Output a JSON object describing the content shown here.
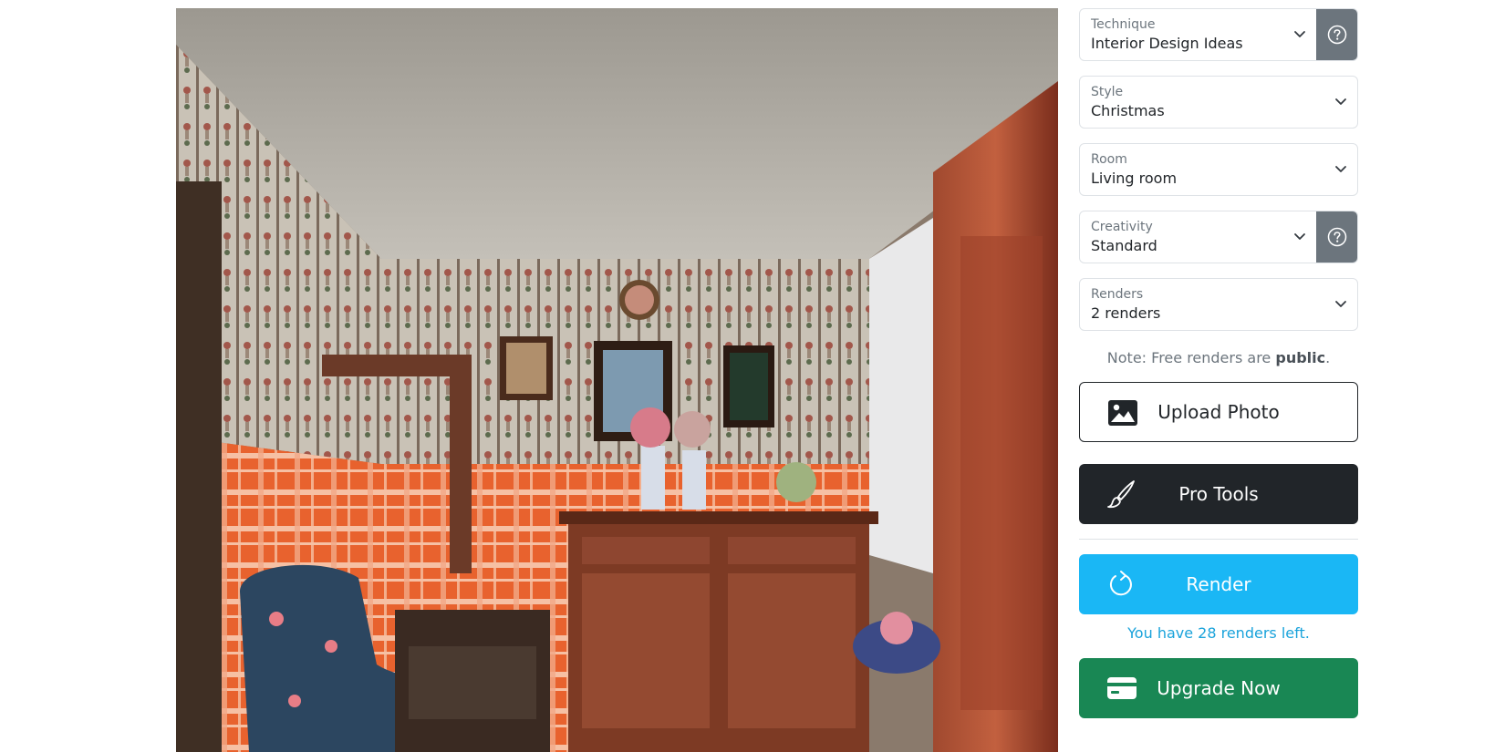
{
  "form": {
    "technique": {
      "label": "Technique",
      "value": "Interior Design Ideas"
    },
    "style": {
      "label": "Style",
      "value": "Christmas"
    },
    "room": {
      "label": "Room",
      "value": "Living room"
    },
    "creativity": {
      "label": "Creativity",
      "value": "Standard"
    },
    "renders": {
      "label": "Renders",
      "value": "2 renders"
    }
  },
  "note": {
    "prefix": "Note: Free renders are ",
    "emphasis": "public",
    "suffix": "."
  },
  "buttons": {
    "upload": "Upload Photo",
    "pro_tools": "Pro Tools",
    "render": "Render",
    "upgrade": "Upgrade Now"
  },
  "renders_left": "You have 28 renders left.",
  "icons": {
    "upload": "image-icon",
    "pro_tools": "brush-icon",
    "render": "refresh-icon",
    "upgrade": "credit-card-icon",
    "help": "question-circle-icon",
    "dropdown": "chevron-down-icon"
  },
  "colors": {
    "render_button": "#1ab7f5",
    "upgrade_button": "#198754",
    "pro_button": "#212529",
    "help_button": "#6c757d"
  }
}
